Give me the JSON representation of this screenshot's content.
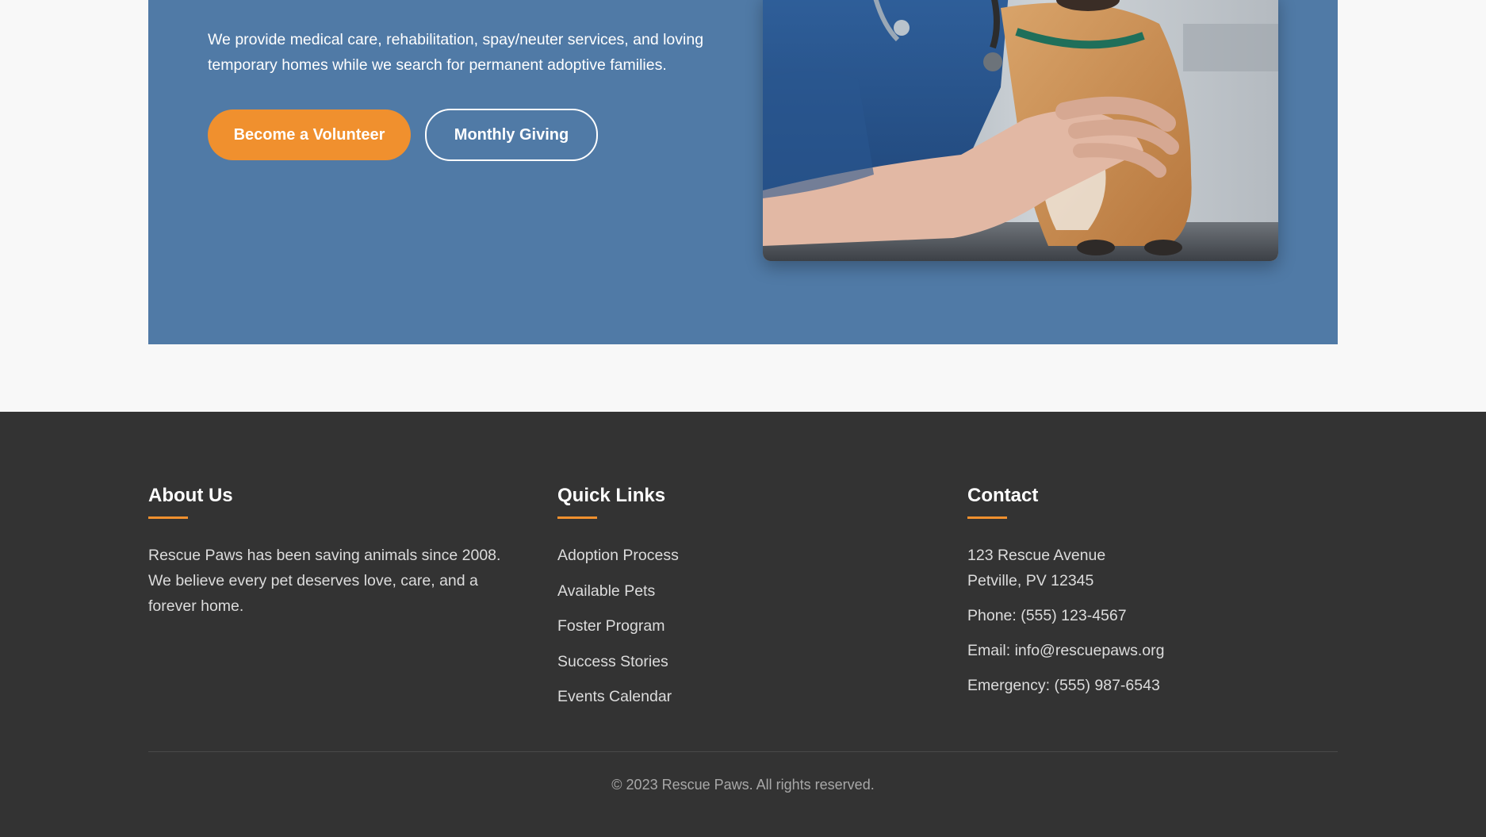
{
  "hero": {
    "description": "We provide medical care, rehabilitation, spay/neuter services, and loving temporary homes while we search for permanent adoptive families.",
    "volunteer_button": "Become a Volunteer",
    "giving_button": "Monthly Giving",
    "background_color": "#507aa6",
    "accent_color": "#f0902e"
  },
  "footer": {
    "about": {
      "heading": "About Us",
      "text": "Rescue Paws has been saving animals since 2008. We believe every pet deserves love, care, and a forever home."
    },
    "quick_links": {
      "heading": "Quick Links",
      "items": [
        "Adoption Process",
        "Available Pets",
        "Foster Program",
        "Success Stories",
        "Events Calendar"
      ]
    },
    "contact": {
      "heading": "Contact",
      "address_line1": "123 Rescue Avenue",
      "address_line2": "Petville, PV 12345",
      "phone": "Phone: (555) 123-4567",
      "email": "Email: info@rescuepaws.org",
      "emergency": "Emergency: (555) 987-6543"
    },
    "copyright": "© 2023 Rescue Paws. All rights reserved.",
    "background_color": "#333333"
  }
}
